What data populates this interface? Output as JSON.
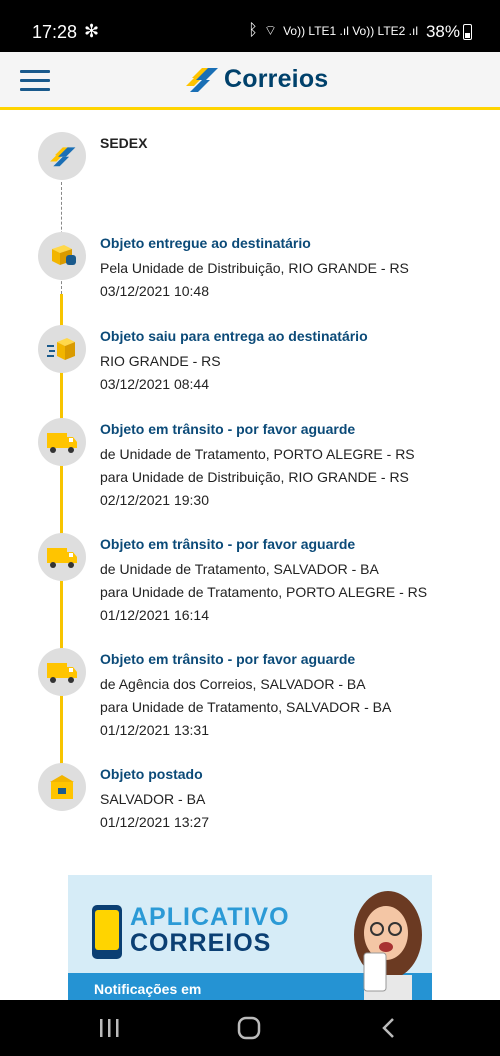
{
  "status_bar": {
    "time": "17:28",
    "network": "Vo)) LTE1 .ıl Vo)) LTE2 .ıl",
    "battery": "38%"
  },
  "header": {
    "logo_text": "Correios",
    "menu_icon": "hamburger-menu-icon"
  },
  "timeline": {
    "service": "SEDEX",
    "events": [
      {
        "icon": "package-delivered-icon",
        "title": "Objeto entregue ao destinatário",
        "lines": [
          "Pela Unidade de Distribuição, RIO GRANDE - RS",
          "03/12/2021 10:48"
        ]
      },
      {
        "icon": "package-out-for-delivery-icon",
        "title": "Objeto saiu para entrega ao destinatário",
        "lines": [
          "RIO GRANDE - RS",
          "03/12/2021 08:44"
        ]
      },
      {
        "icon": "truck-icon",
        "title": "Objeto em trânsito - por favor aguarde",
        "lines": [
          "de Unidade de Tratamento, PORTO ALEGRE - RS",
          "para Unidade de Distribuição, RIO GRANDE - RS",
          "02/12/2021 19:30"
        ]
      },
      {
        "icon": "truck-icon",
        "title": "Objeto em trânsito - por favor aguarde",
        "lines": [
          "de Unidade de Tratamento, SALVADOR - BA",
          "para Unidade de Tratamento, PORTO ALEGRE - RS",
          "01/12/2021 16:14"
        ]
      },
      {
        "icon": "truck-icon",
        "title": "Objeto em trânsito - por favor aguarde",
        "lines": [
          "de Agência dos Correios, SALVADOR - BA",
          "para Unidade de Tratamento, SALVADOR - BA",
          "01/12/2021 13:31"
        ]
      },
      {
        "icon": "post-office-icon",
        "title": "Objeto postado",
        "lines": [
          "SALVADOR - BA",
          "01/12/2021 13:27"
        ]
      }
    ]
  },
  "banner": {
    "line1": "APLICATIVO",
    "line2": "CORREIOS",
    "line3": "Notificações em"
  },
  "colors": {
    "brand_blue": "#00416b",
    "brand_yellow": "#ffd400",
    "title_blue": "#0b4a78"
  }
}
